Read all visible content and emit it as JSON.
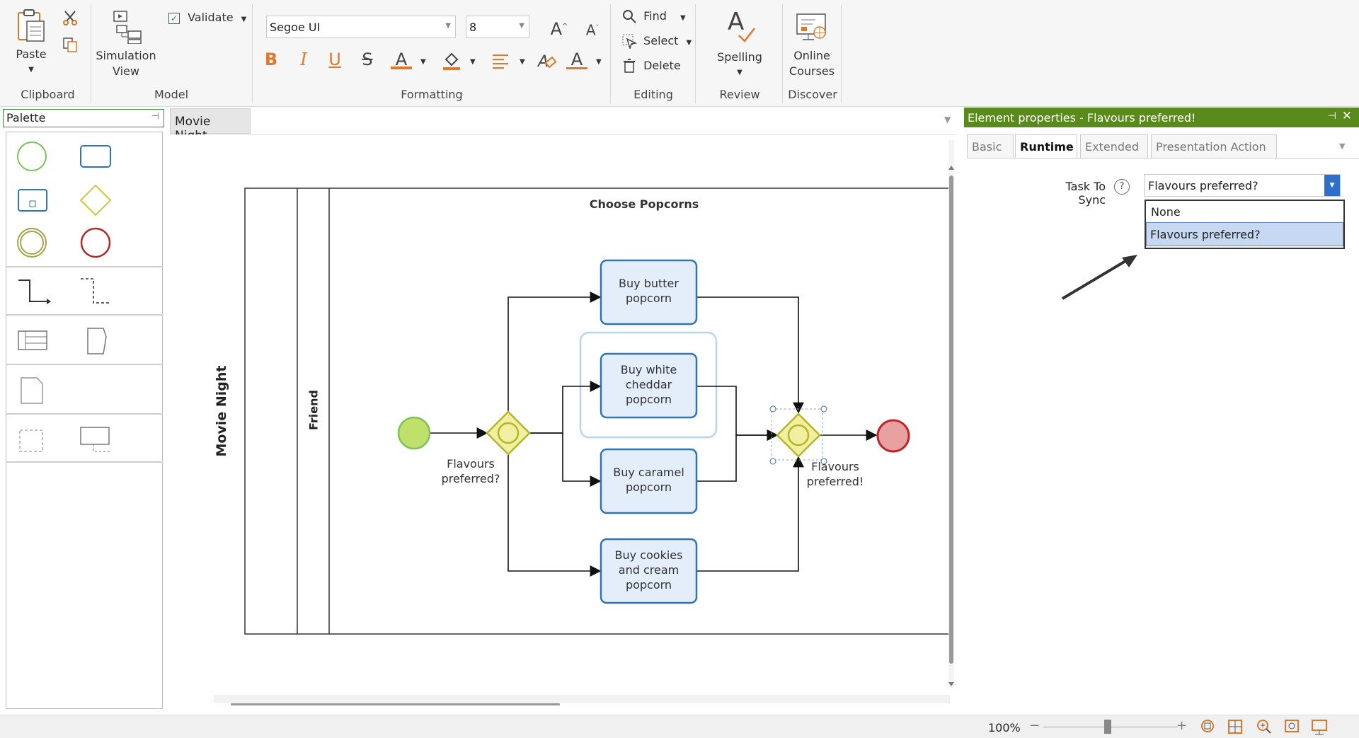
{
  "ribbon": {
    "clipboard": {
      "group_label": "Clipboard",
      "paste_label": "Paste"
    },
    "model": {
      "group_label": "Model",
      "simulation_label_1": "Simulation",
      "simulation_label_2": "View",
      "validate_label": "Validate"
    },
    "formatting": {
      "group_label": "Formatting",
      "font_name": "Segoe UI",
      "font_size": "8"
    },
    "editing": {
      "group_label": "Editing",
      "find_label": "Find",
      "select_label": "Select",
      "delete_label": "Delete"
    },
    "review": {
      "group_label": "Review",
      "spelling_label": "Spelling"
    },
    "discover": {
      "group_label": "Discover",
      "courses_label_1": "Online",
      "courses_label_2": "Courses"
    }
  },
  "palette": {
    "title": "Palette"
  },
  "document": {
    "tab_label": "Movie Night"
  },
  "diagram": {
    "pool_label": "Movie Night",
    "lane_label": "Friend",
    "group_title": "Choose Popcorns",
    "tasks": [
      {
        "line1": "Buy butter",
        "line2": "popcorn",
        "line3": ""
      },
      {
        "line1": "Buy white",
        "line2": "cheddar",
        "line3": "popcorn"
      },
      {
        "line1": "Buy caramel",
        "line2": "popcorn",
        "line3": ""
      },
      {
        "line1": "Buy cookies",
        "line2": "and cream",
        "line3": "popcorn"
      }
    ],
    "split_label_1": "Flavours",
    "split_label_2": "preferred?",
    "join_label_1": "Flavours",
    "join_label_2": "preferred!"
  },
  "properties": {
    "title": "Element properties - Flavours preferred!",
    "tabs": [
      "Basic",
      "Runtime",
      "Extended",
      "Presentation Action"
    ],
    "active_tab": "Runtime",
    "field_label": "Task To Sync",
    "field_value": "Flavours preferred?",
    "options": [
      "None",
      "Flavours preferred?"
    ],
    "selected_option": "Flavours preferred?"
  },
  "status": {
    "zoom": "100%"
  },
  "colors": {
    "accent_green": "#5a8a1c",
    "task_border": "#2f74b5",
    "task_fill": "#e4eefb",
    "gateway": "#c9c93a",
    "start": "#bfe06a",
    "end": "#e8a0a0"
  }
}
